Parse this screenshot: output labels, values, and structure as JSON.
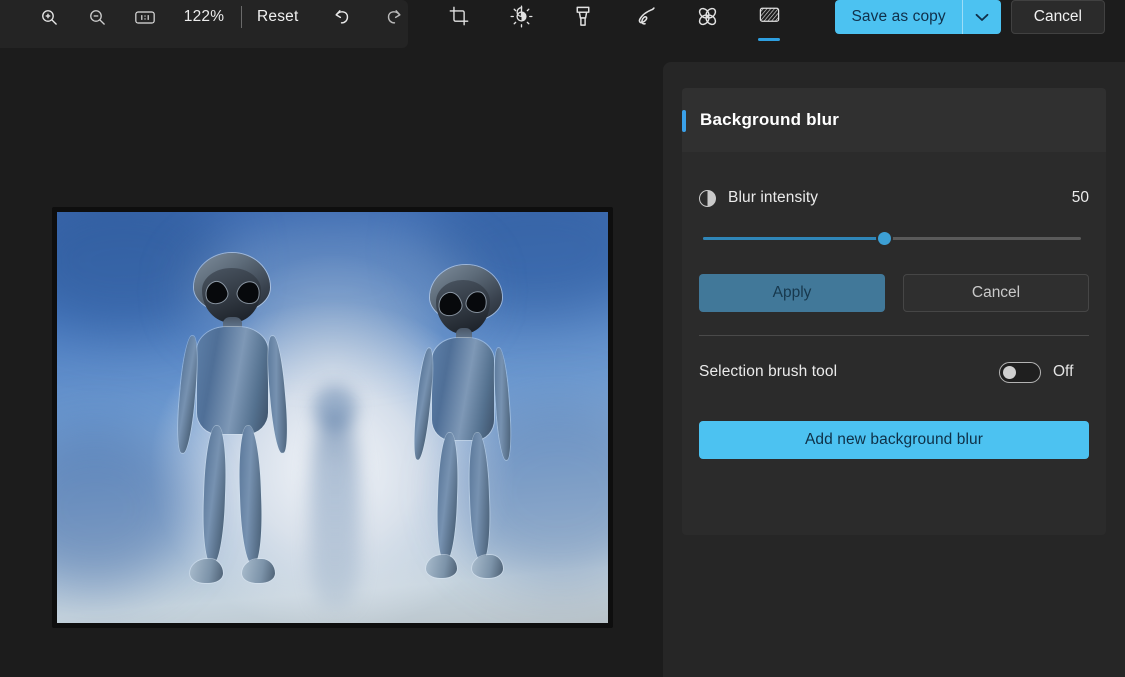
{
  "toolbar": {
    "zoom_in_icon": "zoom-in-icon",
    "zoom_out_icon": "zoom-out-icon",
    "actual_size_icon": "actual-size-icon",
    "zoom_level": "122%",
    "reset_label": "Reset",
    "undo_icon": "undo-icon",
    "redo_icon": "redo-icon",
    "tools": [
      {
        "name": "crop",
        "icon": "crop-icon",
        "selected": false
      },
      {
        "name": "adjustment",
        "icon": "brightness-icon",
        "selected": false
      },
      {
        "name": "marker",
        "icon": "marker-icon",
        "selected": false
      },
      {
        "name": "pen",
        "icon": "pen-icon",
        "selected": false
      },
      {
        "name": "eraser",
        "icon": "eraser-icon",
        "selected": false
      },
      {
        "name": "blur",
        "icon": "blur-icon",
        "selected": true
      }
    ],
    "save_as_copy_label": "Save as copy",
    "save_dropdown_icon": "chevron-down-icon",
    "cancel_label": "Cancel"
  },
  "canvas": {
    "image_name": "two-grey-aliens-photo"
  },
  "panel": {
    "title": "Background blur",
    "intensity": {
      "icon": "contrast-icon",
      "label": "Blur intensity",
      "value": "50",
      "percent": 50
    },
    "apply_label": "Apply",
    "cancel_label": "Cancel",
    "selection_brush": {
      "label": "Selection brush tool",
      "state": "Off",
      "on": false
    },
    "add_label": "Add new background blur"
  },
  "colors": {
    "accent": "#4cc2f1",
    "accent_bar": "#3aa0e8",
    "slider_fill": "#2f86b8",
    "page_bg": "#1c1c1c",
    "panel_bg": "#262626",
    "card_bg": "#2b2b2b"
  }
}
